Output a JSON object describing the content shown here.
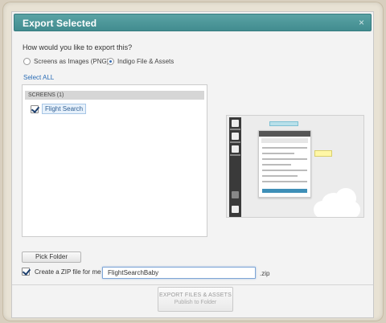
{
  "dialog": {
    "title": "Export Selected",
    "close_icon": "×"
  },
  "export": {
    "question": "How would you like to export this?",
    "options": [
      {
        "label": "Screens as Images (PNG)",
        "selected": false
      },
      {
        "label": "Indigo File & Assets",
        "selected": true
      }
    ]
  },
  "screens": {
    "select_all": "Select ALL",
    "header": "SCREENS (1)",
    "items": [
      {
        "label": "Flight Search",
        "checked": true
      }
    ]
  },
  "preview": {
    "icon": "screen-thumbnail"
  },
  "folder": {
    "pick_label": "Pick Folder"
  },
  "zip": {
    "checkbox_label": "Create a ZIP file for me",
    "checked": true,
    "filename": "FlightSearchBaby",
    "extension": ".zip"
  },
  "footer": {
    "export_label": "EXPORT FILES & ASSETS",
    "export_sub": "Publish to Folder"
  },
  "colors": {
    "titlebar": "#4f9a9d",
    "link": "#2a6cb5",
    "checkbox_mark": "#1b3e6e"
  }
}
